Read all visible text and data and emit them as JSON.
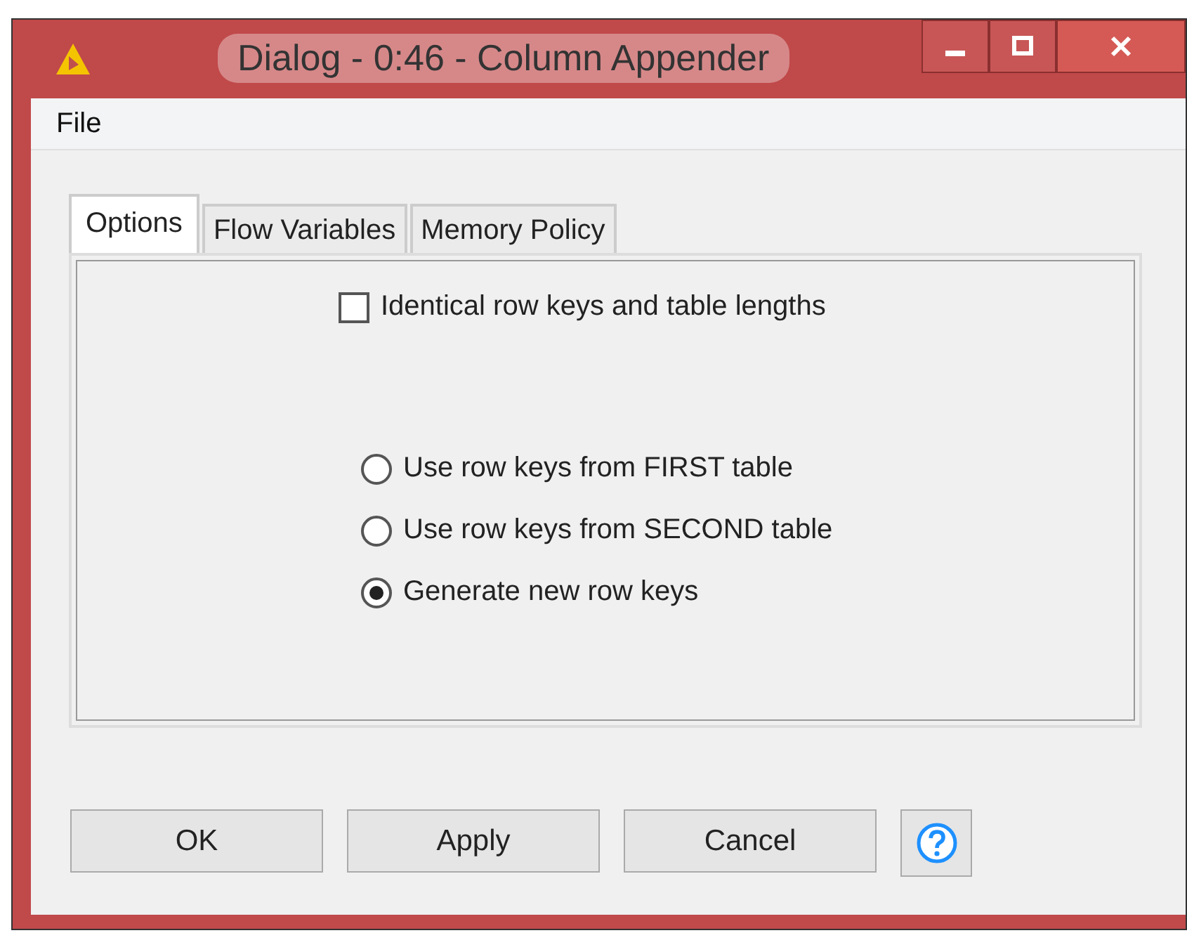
{
  "window": {
    "title": "Dialog - 0:46 - Column Appender"
  },
  "menu": [
    "File"
  ],
  "tabs": [
    {
      "label": "Options",
      "selected": true
    },
    {
      "label": "Flow Variables",
      "selected": false
    },
    {
      "label": "Memory Policy",
      "selected": false
    }
  ],
  "checkbox": {
    "label": "Identical row keys and table lengths",
    "checked": false
  },
  "radios": [
    {
      "label": "Use row keys from FIRST table",
      "selected": false
    },
    {
      "label": "Use row keys from SECOND table",
      "selected": false
    },
    {
      "label": "Generate new row keys",
      "selected": true
    }
  ],
  "buttons": [
    "OK",
    "Apply",
    "Cancel"
  ]
}
